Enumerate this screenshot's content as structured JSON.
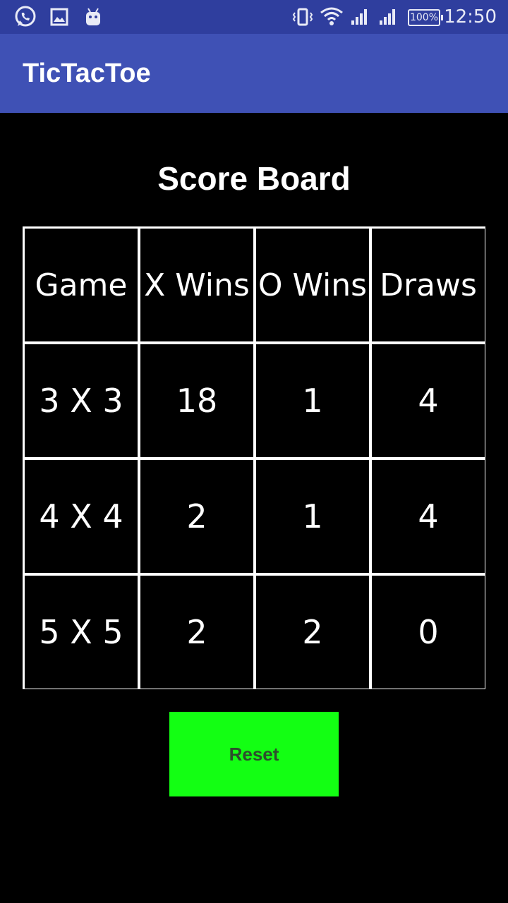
{
  "status_bar": {
    "time": "12:50",
    "battery": "100%",
    "icons": [
      "whatsapp-icon",
      "gallery-icon",
      "android-icon",
      "vibrate-icon",
      "wifi-icon",
      "signal-icon",
      "signal-icon",
      "battery-icon"
    ]
  },
  "app_bar": {
    "title": "TicTacToe",
    "color": "#3f51b5"
  },
  "scoreboard": {
    "title": "Score Board",
    "headers": [
      "Game",
      "X Wins",
      "O Wins",
      "Draws"
    ],
    "rows": [
      [
        "3 X 3",
        "18",
        "1",
        "4"
      ],
      [
        "4 X 4",
        "2",
        "1",
        "4"
      ],
      [
        "5 X 5",
        "2",
        "2",
        "0"
      ]
    ]
  },
  "reset_button": {
    "label": "Reset",
    "color": "#13ff13"
  }
}
